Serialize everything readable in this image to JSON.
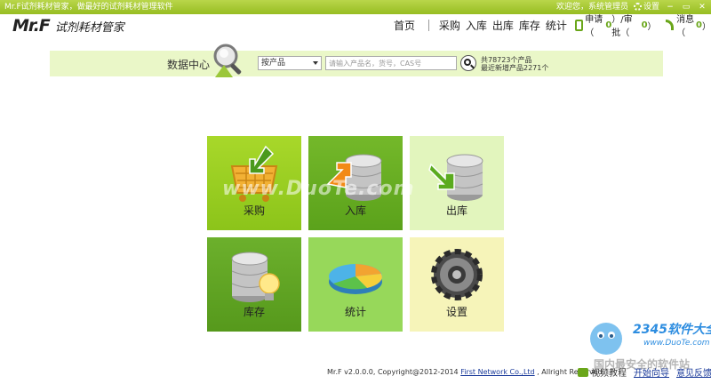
{
  "titlebar": {
    "title": "Mr.F试剂耗材管家，做最好的试剂耗材管理软件",
    "welcome": "欢迎您，系统管理员",
    "settings": "设置",
    "min": "−",
    "max": "▭",
    "close": "✕"
  },
  "logo": {
    "main": "Mr.F",
    "sub": "试剂耗材管家"
  },
  "nav": {
    "home": "首页",
    "items": [
      "采购",
      "入库",
      "出库",
      "库存",
      "统计"
    ],
    "apply_label": "申请（",
    "apply_count": "0",
    "approve_label": "）/审批（",
    "approve_count": "0",
    "apply_end": "）",
    "msg_label": "消息（",
    "msg_count": "0",
    "msg_end": "）"
  },
  "search": {
    "title": "数据中心",
    "select_value": "按产品",
    "placeholder": "请输入产品名，货号，CAS号",
    "stats_line1": "共78723个产品",
    "stats_line2": "最近新增产品2271个"
  },
  "tiles": [
    {
      "label": "采购",
      "icon": "cart-icon"
    },
    {
      "label": "入库",
      "icon": "database-in-icon"
    },
    {
      "label": "出库",
      "icon": "database-out-icon"
    },
    {
      "label": "库存",
      "icon": "database-bulb-icon"
    },
    {
      "label": "统计",
      "icon": "pie-chart-icon"
    },
    {
      "label": "设置",
      "icon": "gear-icon"
    }
  ],
  "watermark": "www.DuoTe.com",
  "footer": {
    "version": "Mr.F v2.0.0.0, Copyright@2012-2014 ",
    "company": "First Network Co.,Ltd",
    "rights": " , Allright Reserved.",
    "video": "视频教程",
    "help": "开始向导",
    "feedback": "意见反馈"
  },
  "corner_logo": {
    "brand": "2345软件大全",
    "url": "www.DuoTe.com",
    "safe": "国内最安全的软件站"
  },
  "colors": {
    "accent": "#97bd22",
    "strip": "#eaf7c8",
    "link": "#1a3a9a"
  }
}
